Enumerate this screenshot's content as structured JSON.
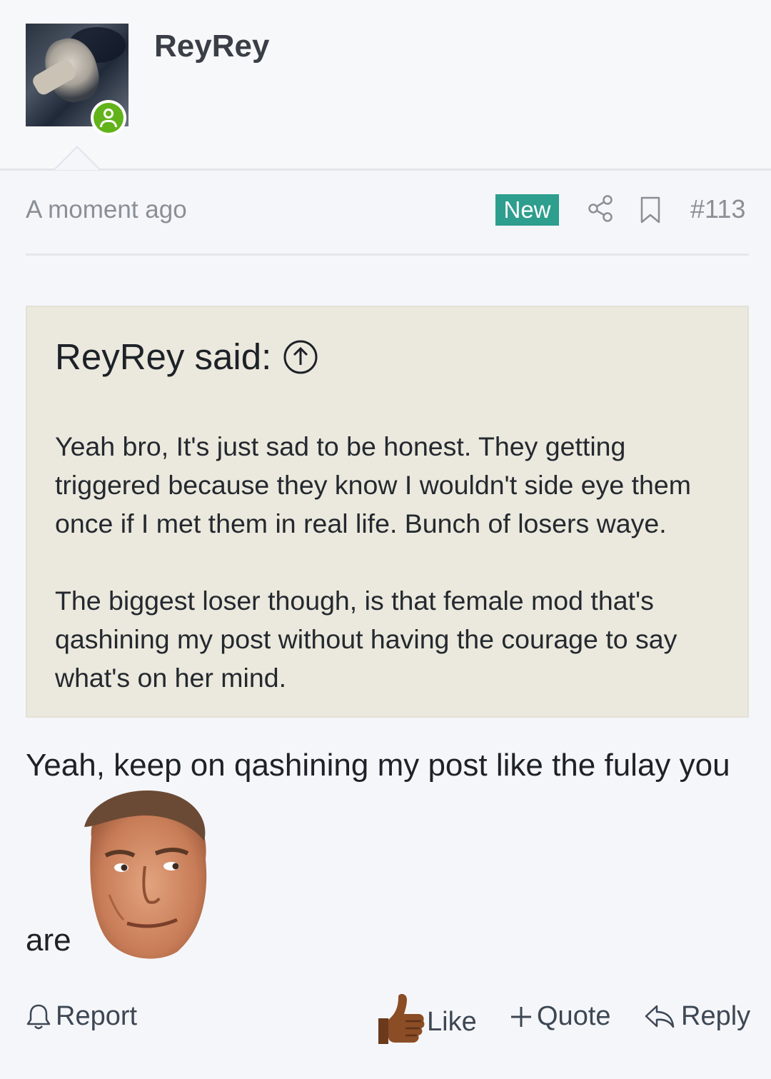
{
  "user": {
    "name": "ReyRey",
    "status": "online"
  },
  "post": {
    "timestamp": "A moment ago",
    "badge": "New",
    "number": "#113",
    "quote": {
      "author_label": "ReyRey said:",
      "paragraphs": [
        "Yeah bro, It's just sad to be honest. They getting triggered because they know I wouldn't side eye them once if I met them in real life. Bunch of losers waye.",
        "The biggest loser though, is that female mod that's qashining my post without having the courage to say what's on her mind."
      ]
    },
    "body_line1": "Yeah, keep on qashining my post like the fulay you",
    "body_line2": "are"
  },
  "actions": {
    "report": "Report",
    "like": "Like",
    "quote": "Quote",
    "reply": "Reply"
  },
  "icons": {
    "online": "user-online-icon",
    "share": "share-icon",
    "bookmark": "bookmark-icon",
    "quote_jump": "arrow-up-circle-icon",
    "report": "bell-icon",
    "like": "thumbs-up-emoji",
    "quote": "plus-icon",
    "reply": "reply-icon"
  },
  "colors": {
    "badge_new": "#2e9e8e",
    "quote_background": "#ebe8dd",
    "online_green": "#62b319"
  }
}
